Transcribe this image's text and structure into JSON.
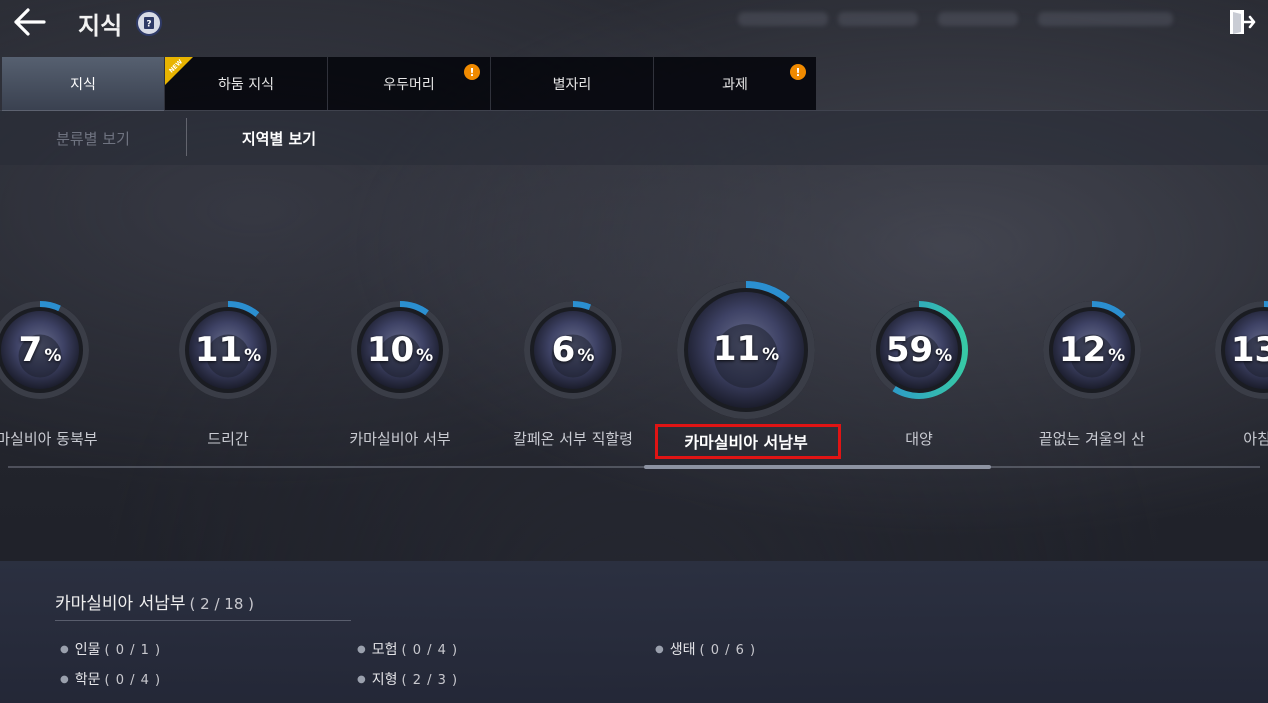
{
  "header": {
    "title": "지식",
    "help_icon": "question-book-icon",
    "back_icon": "arrow-left-icon",
    "exit_icon": "exit-door-icon"
  },
  "tabs": [
    {
      "label": "지식",
      "active": true,
      "badge": ""
    },
    {
      "label": "하둠 지식",
      "active": false,
      "new_ribbon": "NEW",
      "badge": ""
    },
    {
      "label": "우두머리",
      "active": false,
      "badge": "!"
    },
    {
      "label": "별자리",
      "active": false,
      "badge": ""
    },
    {
      "label": "과제",
      "active": false,
      "badge": "!"
    }
  ],
  "subtabs": {
    "by_category": "분류별 보기",
    "by_region": "지역별 보기"
  },
  "regions": [
    {
      "name": "카마실비아 동북부",
      "percent": "7",
      "progress": 0.07
    },
    {
      "name": "드리간",
      "percent": "11",
      "progress": 0.11
    },
    {
      "name": "카마실비아 서부",
      "percent": "10",
      "progress": 0.1
    },
    {
      "name": "칼페온 서부 직할령",
      "percent": "6",
      "progress": 0.06
    },
    {
      "name": "카마실비아 서남부",
      "percent": "11",
      "progress": 0.11,
      "selected": true
    },
    {
      "name": "대양",
      "percent": "59",
      "progress": 0.59
    },
    {
      "name": "끝없는 겨울의 산",
      "percent": "12",
      "progress": 0.12
    },
    {
      "name": "아침의",
      "percent": "13",
      "progress": 0.13
    }
  ],
  "percent_unit": "%",
  "detail": {
    "title": "카마실비아 서남부",
    "count": "( 2 / 18 )",
    "stats": [
      {
        "label": "인물",
        "value": "( 0 / 1 )"
      },
      {
        "label": "모험",
        "value": "( 0 / 4 )"
      },
      {
        "label": "생태",
        "value": "( 0 / 6 )"
      },
      {
        "label": "학문",
        "value": "( 0 / 4 )"
      },
      {
        "label": "지형",
        "value": "( 2 / 3 )"
      }
    ]
  },
  "colors": {
    "ring_blue": "#2b8fd0",
    "ring_teal": "#37c9a6",
    "badge_orange": "#f08a00",
    "highlight_red": "#e01414"
  }
}
